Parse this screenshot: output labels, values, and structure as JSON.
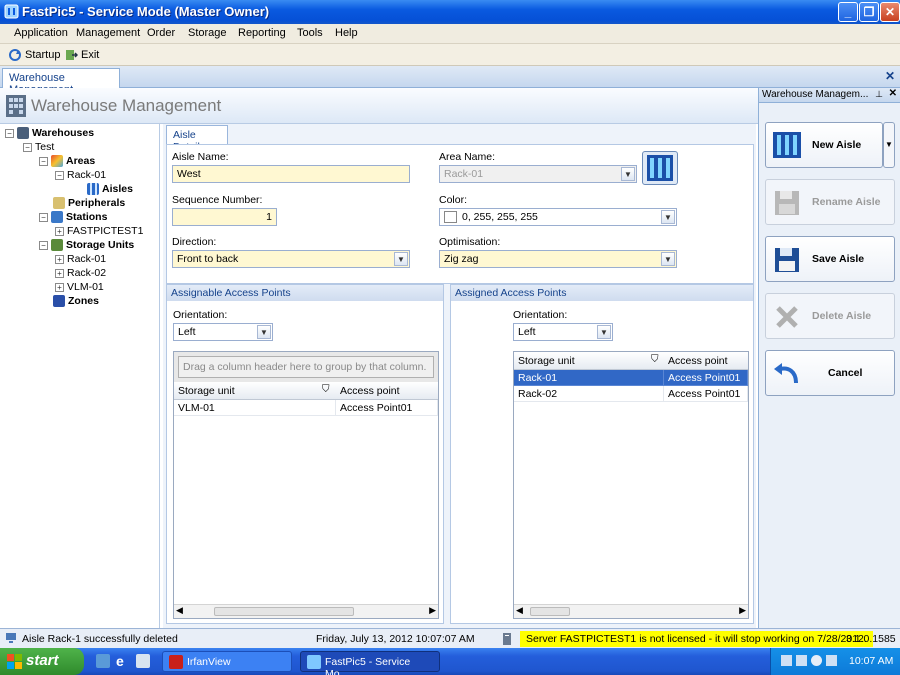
{
  "window": {
    "title": "FastPic5 - Service Mode (Master Owner)"
  },
  "menu": [
    "Application",
    "Management",
    "Order",
    "Storage",
    "Reporting",
    "Tools",
    "Help"
  ],
  "toolbar": {
    "startup": "Startup",
    "exit": "Exit"
  },
  "doc_tab": {
    "label": "Warehouse Management"
  },
  "main_header": {
    "title": "Warehouse Management"
  },
  "tree": {
    "root": "Warehouses",
    "site": "Test",
    "areas": "Areas",
    "rack": "Rack-01",
    "aisles": "Aisles",
    "peripherals": "Peripherals",
    "stations": "Stations",
    "station1": "FASTPICTEST1",
    "storage_units": "Storage Units",
    "su1": "Rack-01",
    "su2": "Rack-02",
    "su3": "VLM-01",
    "zones": "Zones"
  },
  "detail": {
    "tab": "Aisle Details",
    "aisle_name_label": "Aisle Name:",
    "aisle_name": "West",
    "area_name_label": "Area Name:",
    "area_name": "Rack-01",
    "seq_label": "Sequence Number:",
    "seq": "1",
    "color_label": "Color:",
    "color_value": "0, 255, 255, 255",
    "direction_label": "Direction:",
    "direction": "Front to back",
    "optimisation_label": "Optimisation:",
    "optimisation": "Zig zag"
  },
  "assignable": {
    "title": "Assignable Access Points",
    "orientation_label": "Orientation:",
    "orientation": "Left",
    "group_hint": "Drag a column header here to group by that column.",
    "col1": "Storage unit",
    "col2": "Access point",
    "rows": [
      {
        "su": "VLM-01",
        "ap": "Access Point01"
      }
    ]
  },
  "assigned": {
    "title": "Assigned Access Points",
    "orientation_label": "Orientation:",
    "orientation": "Left",
    "col1": "Storage unit",
    "col2": "Access point",
    "rows": [
      {
        "su": "Rack-01",
        "ap": "Access Point01"
      },
      {
        "su": "Rack-02",
        "ap": "Access Point01"
      }
    ]
  },
  "right_panel": {
    "title": "Warehouse  Managem...",
    "new": "New Aisle",
    "rename": "Rename Aisle",
    "save": "Save Aisle",
    "delete": "Delete Aisle",
    "cancel": "Cancel"
  },
  "status": {
    "message": "Aisle Rack-1 successfully deleted",
    "datetime": "Friday, July 13, 2012 10:07:07 AM",
    "license": "Server FASTPICTEST1 is not licensed - it will stop working on 7/28/2012.",
    "version": "3.1.0.1585"
  },
  "taskbar": {
    "start": "start",
    "item1": "IrfanView",
    "item2": "FastPic5 - Service Mo...",
    "clock": "10:07 AM"
  },
  "colors": {
    "accent": "#3168c6",
    "field_bg": "#fff8d2",
    "license_bg": "#ffff00"
  }
}
